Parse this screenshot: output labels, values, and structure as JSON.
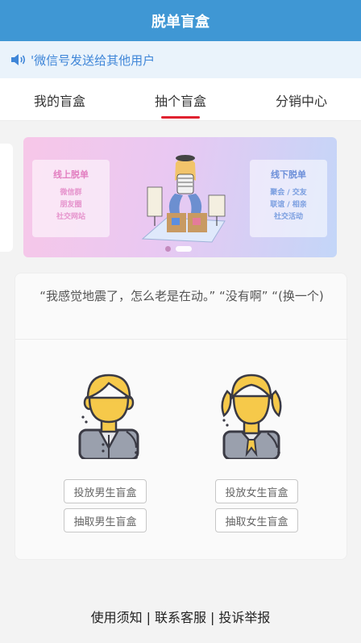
{
  "header": {
    "title": "脱单盲盒"
  },
  "notice": {
    "text": "'微信号发送给其他用户",
    "icon": "speaker-icon",
    "color": "#3f86d8"
  },
  "tabs": [
    {
      "label": "我的盲盒",
      "active": false
    },
    {
      "label": "抽个盲盒",
      "active": true
    },
    {
      "label": "分销中心",
      "active": false
    }
  ],
  "banner": {
    "left_heading": "线上脱单",
    "left_lines": [
      "微信群",
      "朋友圈",
      "社交网站"
    ],
    "right_heading": "线下脱单",
    "right_lines": [
      "聚会 / 交友",
      "联谊 / 相亲",
      "社交活动"
    ],
    "slides": 2,
    "active_slide": 1
  },
  "card": {
    "joke": "“我感觉地震了，怎么老是在动。” “没有啊” “(换一个)",
    "male_avatar": "male-user-icon",
    "female_avatar": "female-user-icon",
    "put_male_label": "投放男生盲盒",
    "draw_male_label": "抽取男生盲盒",
    "put_female_label": "投放女生盲盒",
    "draw_female_label": "抽取女生盲盒"
  },
  "footer": {
    "usage": "使用须知",
    "contact": "联系客服",
    "report": "投诉举报",
    "separator": "|"
  },
  "colors": {
    "header": "#3f97d4",
    "accent_underline": "#e0212f"
  }
}
